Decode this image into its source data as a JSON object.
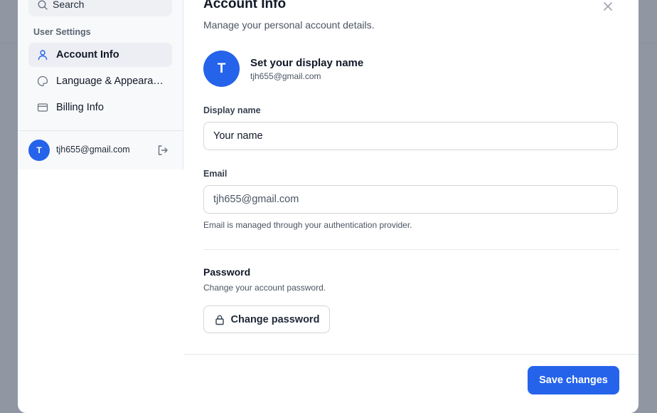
{
  "sidebar": {
    "search": {
      "placeholder": "Search",
      "icon": "search-icon"
    },
    "section_label": "User Settings",
    "items": [
      {
        "label": "Account Info",
        "icon": "user-icon",
        "active": true
      },
      {
        "label": "Language & Appearance",
        "icon": "palette-icon",
        "active": false
      },
      {
        "label": "Billing Info",
        "icon": "credit-card-icon",
        "active": false
      }
    ],
    "user": {
      "initial": "T",
      "email": "tjh655@gmail.com",
      "logout_icon": "logout-icon"
    }
  },
  "main": {
    "title": "Account Info",
    "subtitle": "Manage your personal account details.",
    "profile": {
      "initial": "T",
      "heading": "Set your display name",
      "email": "tjh655@gmail.com"
    },
    "display_name": {
      "label": "Display name",
      "value": "Your name"
    },
    "email": {
      "label": "Email",
      "value": "tjh655@gmail.com",
      "hint": "Email is managed through your authentication provider."
    },
    "password": {
      "title": "Password",
      "subtitle": "Change your account password.",
      "button_label": "Change password",
      "icon": "lock-icon"
    },
    "save_label": "Save changes",
    "close_icon": "close-icon"
  },
  "colors": {
    "accent": "#2563eb",
    "backdrop": "#9097a3",
    "sidebar_bg": "#f8f9fb",
    "active_item_bg": "#eceef3"
  }
}
